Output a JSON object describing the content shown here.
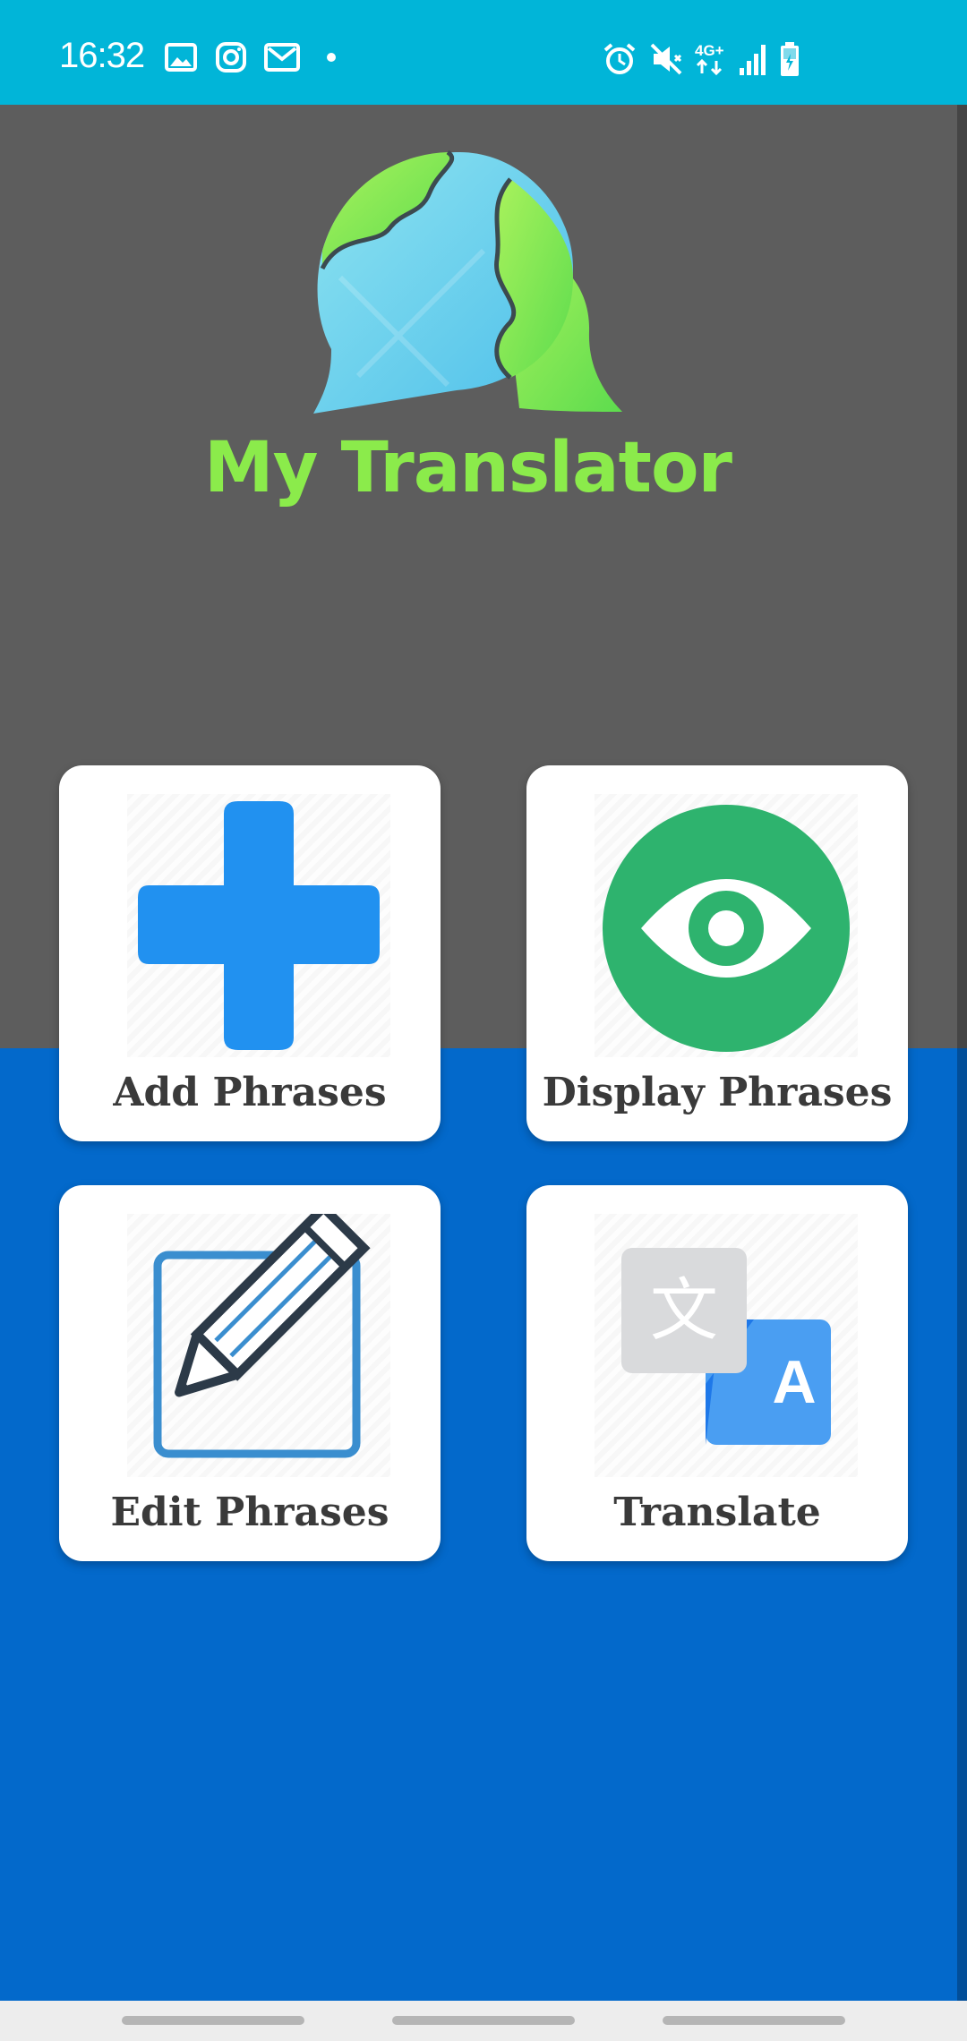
{
  "status_bar": {
    "time": "16:32",
    "left_icons": [
      "gallery-icon",
      "instagram-icon",
      "gmail-icon",
      "dot-icon"
    ],
    "right_icons": [
      "alarm-icon",
      "mute-icon",
      "network-4g-icon",
      "signal-icon",
      "battery-icon"
    ],
    "network_label": "4G+",
    "background": "#01B5D8"
  },
  "app": {
    "title": "My Translator",
    "title_color": "#8BEB4B",
    "top_background": "#5D5D5D",
    "bottom_background": "#0369CB"
  },
  "cards": [
    {
      "id": "add",
      "label": "Add Phrases",
      "icon": "plus-icon",
      "accent": "#2191F0"
    },
    {
      "id": "display",
      "label": "Display Phrases",
      "icon": "eye-icon",
      "accent": "#2EB36E"
    },
    {
      "id": "edit",
      "label": "Edit Phrases",
      "icon": "pencil-edit-icon",
      "accent": "#3A8ECF"
    },
    {
      "id": "translate",
      "label": "Translate",
      "icon": "translate-icon",
      "accent": "#4A9EF2"
    }
  ],
  "translate_icon": {
    "glyph_cjk": "文",
    "glyph_latin": "A"
  }
}
